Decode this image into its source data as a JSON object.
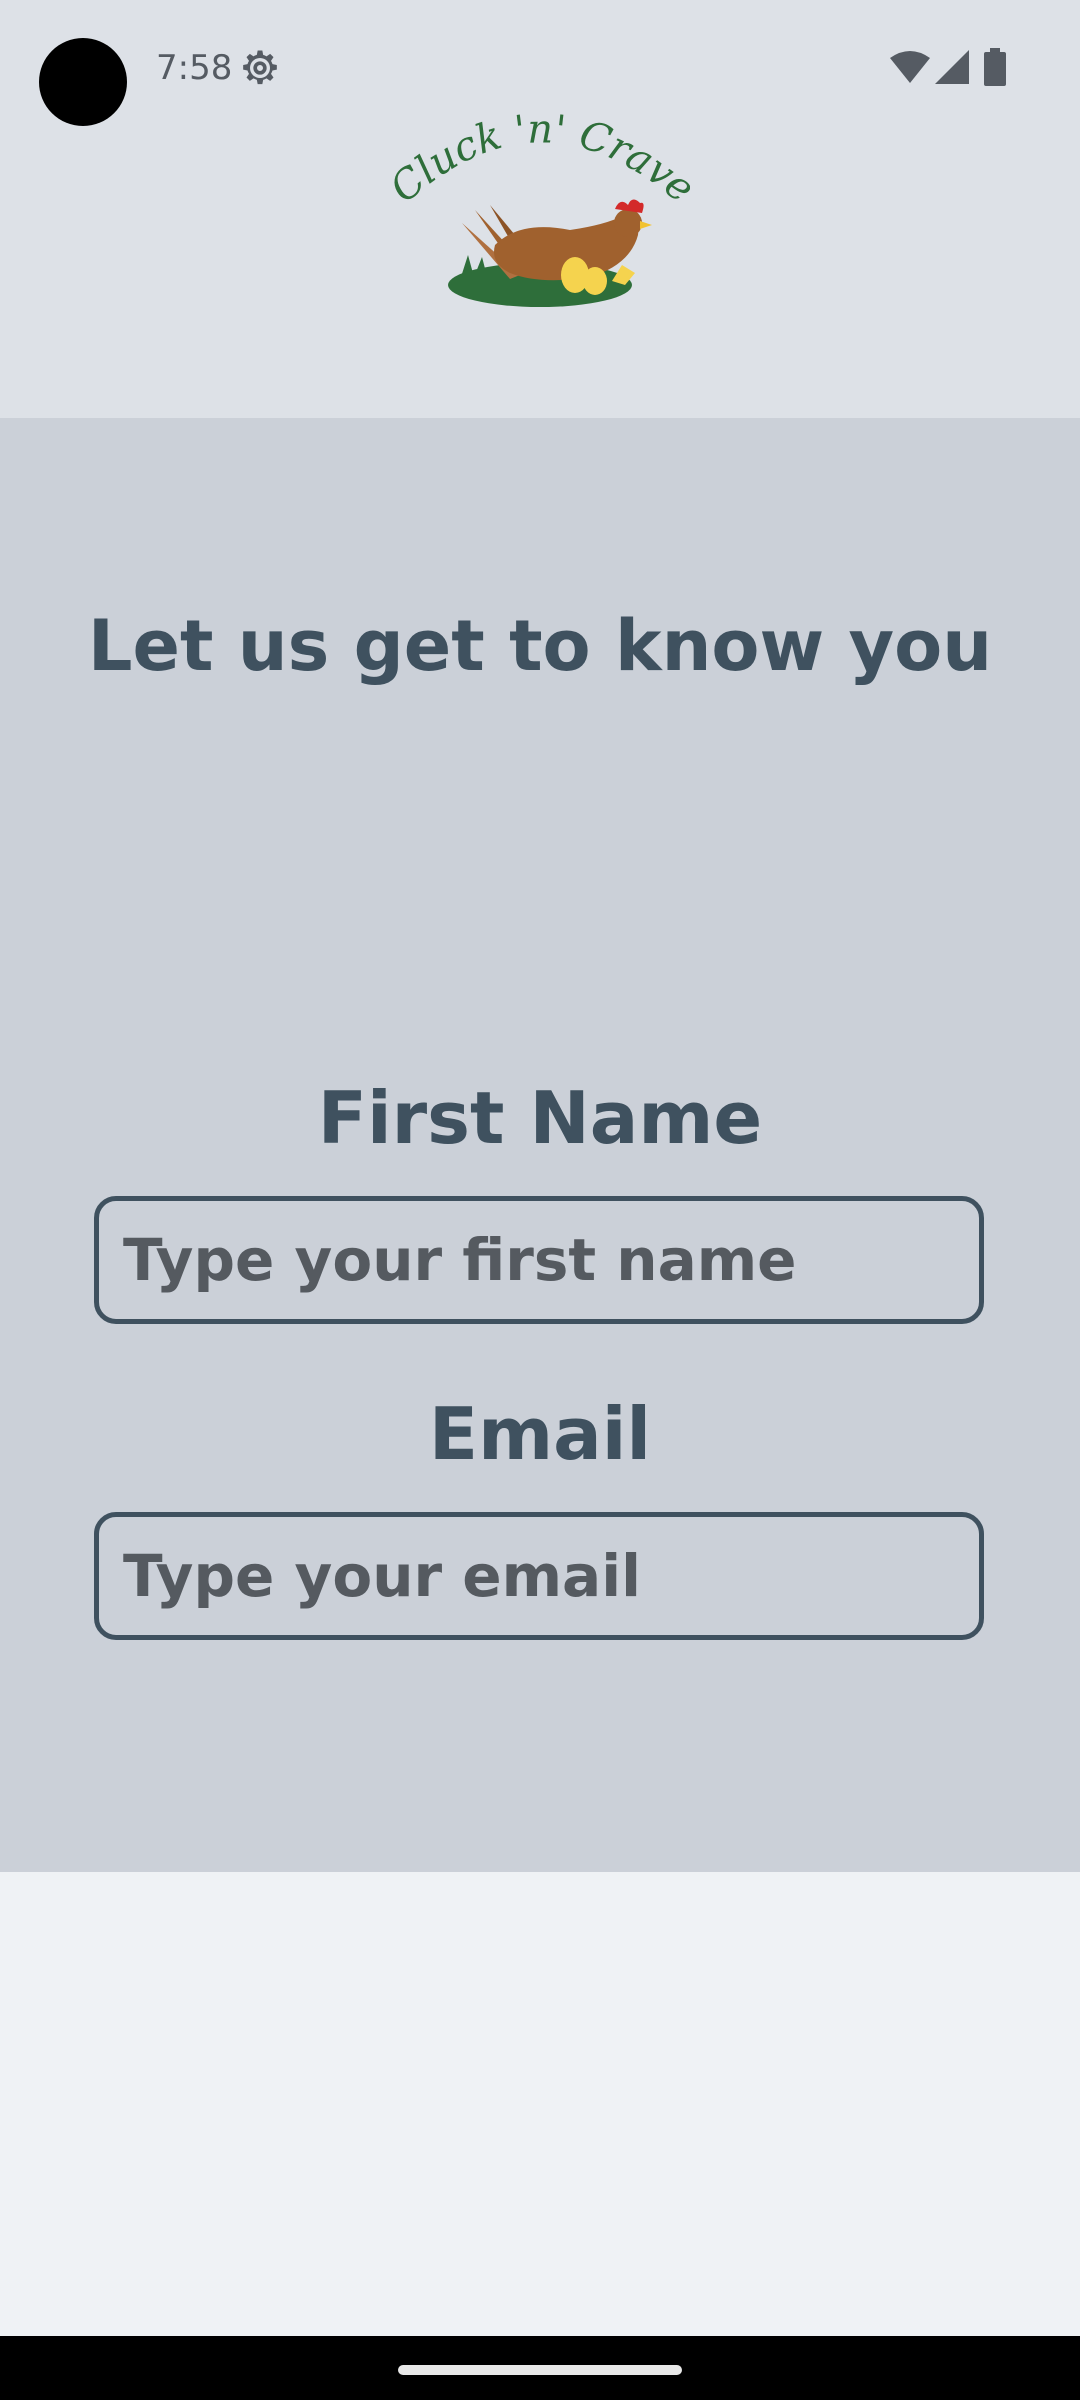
{
  "status_bar": {
    "time": "7:58",
    "icons": [
      "settings-icon",
      "wifi-icon",
      "signal-icon",
      "battery-icon"
    ]
  },
  "logo": {
    "text": "Cluck 'n' Crave"
  },
  "form": {
    "title": "Let us get to know you",
    "first_name": {
      "label": "First Name",
      "placeholder": "Type your first name",
      "value": ""
    },
    "email": {
      "label": "Email",
      "placeholder": "Type your email",
      "value": ""
    }
  },
  "colors": {
    "header_bg": "#DDE1E7",
    "panel_bg": "#CBD0D8",
    "page_bg": "#EFF2F5",
    "text_primary": "#3F515F",
    "logo_green": "#2E6E3A",
    "hen_brown": "#A0612E"
  }
}
